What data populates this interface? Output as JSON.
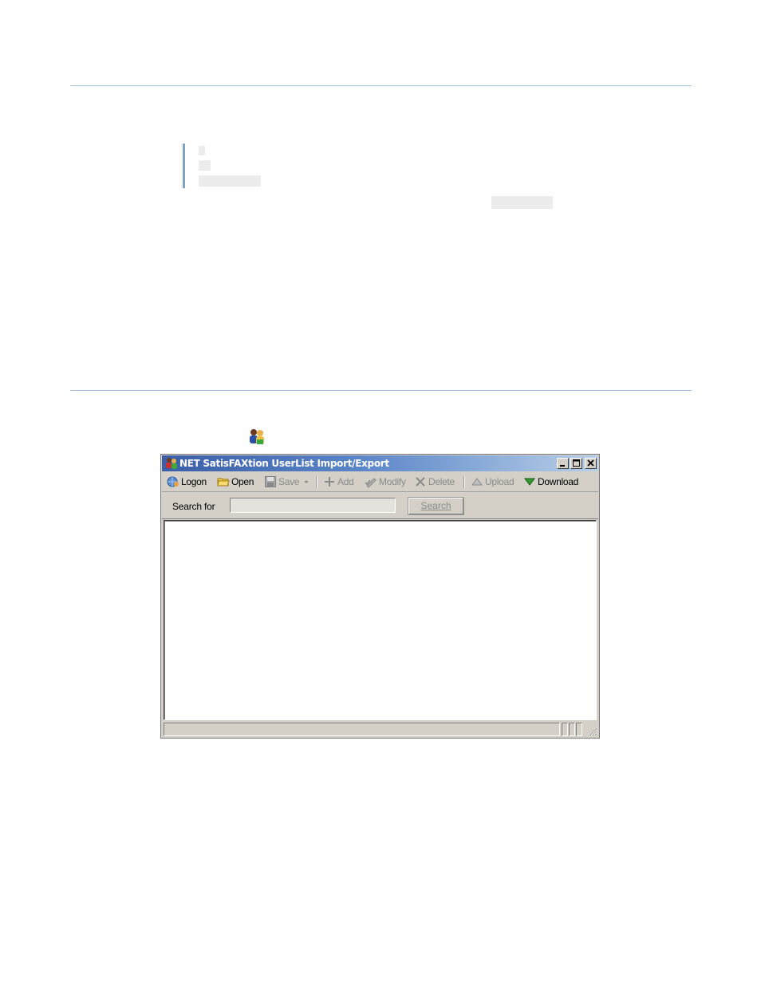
{
  "window": {
    "title": "NET SatisFAXtion UserList Import/Export",
    "controls": {
      "minimize": "_",
      "maximize": "□",
      "close": "✕"
    }
  },
  "toolbar": {
    "logon": "Logon",
    "open": "Open",
    "save": "Save",
    "add": "Add",
    "modify": "Modify",
    "delete": "Delete",
    "upload": "Upload",
    "download": "Download"
  },
  "search": {
    "label": "Search for",
    "value": "",
    "button": "Search"
  },
  "icons": {
    "app": "userlist-app-icon",
    "logon": "globe-user-icon",
    "open": "folder-open-icon",
    "save": "floppy-disk-icon",
    "add": "plus-icon",
    "modify": "pencil-check-icon",
    "delete": "x-delete-icon",
    "upload": "triangle-up-icon",
    "download": "triangle-down-icon"
  },
  "colors": {
    "rule": "#9fbfd6",
    "titlebar_start": "#3a5ea8",
    "titlebar_end": "#b8cfe8",
    "window_face": "#d4d0c8",
    "download_green": "#2e9a2e"
  }
}
